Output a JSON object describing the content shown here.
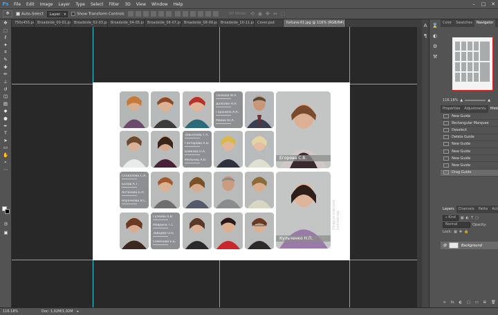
{
  "app": {
    "logo": "Ps"
  },
  "menu": [
    "File",
    "Edit",
    "Image",
    "Layer",
    "Type",
    "Select",
    "Filter",
    "3D",
    "View",
    "Window",
    "Help"
  ],
  "window_controls": [
    "–",
    "□",
    "✕"
  ],
  "options": {
    "auto_select_label": "Auto-Select",
    "auto_select_target": "Layer",
    "transform_label": "Show Transform Controls",
    "mode_3d_label": "3D Mode:"
  },
  "tabs": [
    {
      "label": "750x455.psd",
      "active": false
    },
    {
      "label": "Broadside_00-01.psd",
      "active": false
    },
    {
      "label": "Broadside_02-03.psd",
      "active": false
    },
    {
      "label": "Broadside_04-05.psd",
      "active": false
    },
    {
      "label": "Broadside_06-07.psd",
      "active": false
    },
    {
      "label": "Broadside_08-09.psd",
      "active": false
    },
    {
      "label": "Broadside_10-11.psd",
      "active": false
    },
    {
      "label": "Cover.psd",
      "active": false
    },
    {
      "label": "fortuna-01.jpg @ 116% (RGB/8#)",
      "active": true
    }
  ],
  "photo_grid": {
    "names_cells": [
      {
        "names": [
          "Тасмова Ф.А.",
          "Долкова Н.Н.",
          "Гаранина А.А.",
          "Маева Ю.А."
        ]
      },
      {
        "names": [
          "Завьялова Т.А.",
          "Гончарова А.В.",
          "Байкова Н.А.",
          "Мельниц А.В."
        ]
      },
      {
        "names": [
          "Скакалова С.А.",
          "Белов А.Т.",
          "Антонова Е.Н.",
          "Воронкова В.С."
        ]
      },
      {
        "names": [
          "Гузеева А.В.",
          "Маврина Т.С.",
          "Зайцева О.Н.",
          "Семенова Е.Б."
        ]
      }
    ],
    "big_captions": [
      "Егорова С.В.",
      "Кульченко Н.П."
    ],
    "side_text": "Педагогический коллектив"
  },
  "panels": {
    "top_tabs": [
      "Color",
      "Swatches",
      "Navigator"
    ],
    "zoom": "116.18%",
    "mid_tabs": [
      "Properties",
      "Adjustments",
      "History"
    ],
    "history": [
      "New Guide",
      "Rectangular Marquee",
      "Deselect",
      "Delete Guide",
      "New Guide",
      "New Guide",
      "New Guide",
      "New Guide",
      "Drag Guide"
    ],
    "layer_tabs": [
      "Layers",
      "Channels",
      "Paths",
      "Actions"
    ],
    "kind_label": "Kind",
    "blend": "Normal",
    "lock_label": "Lock:",
    "layer_name": "Background",
    "footer_icons": [
      "∞",
      "fx",
      "◐",
      "▢",
      "▭",
      "⊞",
      "🗑"
    ]
  },
  "status": {
    "zoom": "116.18%",
    "doc": "Doc: 1,02M/1,02M"
  },
  "colors": {
    "guide": "#31c9d6",
    "active_tab": "#696969",
    "history_selected": "#6b6b6b"
  },
  "icons": [
    "move-icon",
    "marquee-icon",
    "lasso-icon",
    "magic-wand-icon",
    "crop-icon",
    "eyedropper-icon",
    "brush-icon",
    "eraser-icon",
    "text-icon",
    "hand-icon",
    "zoom-icon"
  ]
}
